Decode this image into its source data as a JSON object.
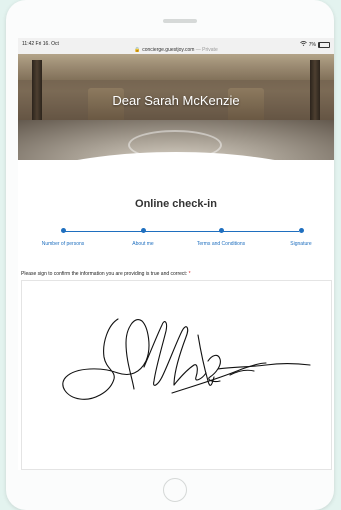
{
  "status_bar": {
    "time": "11:42",
    "date": "Fri 16. Oct",
    "url": "concierge.guestjoy.com",
    "url_suffix": "— Private",
    "battery": "7%"
  },
  "header": {
    "greeting": "Dear Sarah McKenzie"
  },
  "page": {
    "title": "Online check-in"
  },
  "stepper": {
    "steps": [
      {
        "label": "Number of persons"
      },
      {
        "label": "About me"
      },
      {
        "label": "Terms and Conditions"
      },
      {
        "label": "Signature"
      }
    ],
    "color": "#1f6fbf"
  },
  "form": {
    "instruction": "Please sign to confirm the information you are providing is true and correct:",
    "required_mark": "*"
  },
  "icons": [
    "lock-icon",
    "wifi-icon",
    "battery-icon",
    "home-button"
  ]
}
